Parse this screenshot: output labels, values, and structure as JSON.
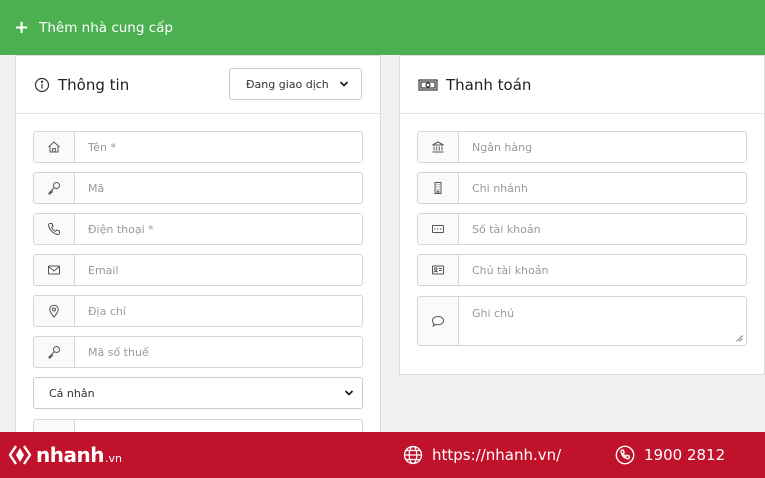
{
  "header": {
    "plus": "+",
    "title": "Thêm nhà cung cấp"
  },
  "info": {
    "title": "Thông tin",
    "status": "Đang giao dịch",
    "fields": [
      {
        "icon": "home-icon",
        "placeholder": "Tên *"
      },
      {
        "icon": "key-icon",
        "placeholder": "Mã"
      },
      {
        "icon": "phone-icon",
        "placeholder": "Điện thoại  *"
      },
      {
        "icon": "envelope-icon",
        "placeholder": "Email"
      },
      {
        "icon": "location-pin-icon",
        "placeholder": "Địa chỉ"
      },
      {
        "icon": "key-icon",
        "placeholder": "Mã số thuế"
      }
    ],
    "type_select": "Cá nhân"
  },
  "payment": {
    "title": "Thanh toán",
    "fields": [
      {
        "icon": "bank-icon",
        "placeholder": "Ngân hàng"
      },
      {
        "icon": "building-icon",
        "placeholder": "Chi nhánh"
      },
      {
        "icon": "card-number-icon",
        "placeholder": "Số tài khoản"
      },
      {
        "icon": "id-card-icon",
        "placeholder": "Chủ tài khoản"
      },
      {
        "icon": "chat-icon",
        "placeholder": "Ghi chú"
      }
    ]
  },
  "footer": {
    "brand": "nhanh",
    "tld": ".vn",
    "website": "https://nhanh.vn/",
    "phone": "1900 2812"
  },
  "colors": {
    "header_bg": "#4caf50",
    "footer_bg": "#c0132b"
  }
}
